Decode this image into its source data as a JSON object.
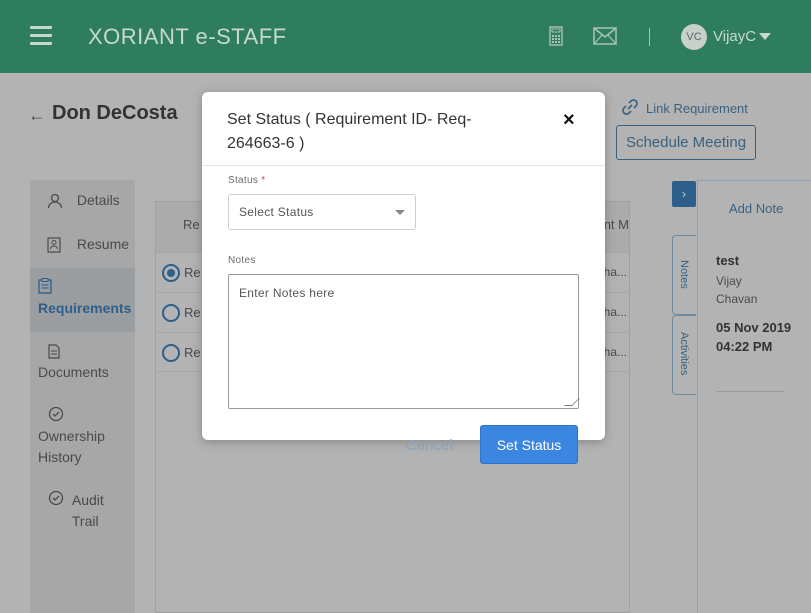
{
  "header": {
    "brand": "XORIANT e-STAFF",
    "user_initials": "VC",
    "username": "VijayC",
    "icons": [
      "menu-icon",
      "calculator-icon",
      "mail-icon",
      "caret-down-icon"
    ]
  },
  "page": {
    "back_label": "←",
    "title": "Don DeCosta",
    "link_requirement": "Link Requirement",
    "schedule_meeting": "Schedule Meeting"
  },
  "sidebar": {
    "items": [
      {
        "label": "Details",
        "icon": "user-icon"
      },
      {
        "label": "Resume",
        "icon": "resume-icon"
      },
      {
        "label": "Requirements",
        "icon": "clipboard-icon"
      },
      {
        "label": "Documents",
        "icon": "document-icon"
      },
      {
        "label": "Ownership History",
        "icon": "history-icon"
      },
      {
        "label": "Audit Trail",
        "icon": "audit-icon"
      }
    ]
  },
  "table": {
    "header_left": "Re",
    "header_right": "nt M",
    "rows": [
      {
        "label": "Re",
        "trail": "ha..."
      },
      {
        "label": "Re",
        "trail": "ha..."
      },
      {
        "label": "Re",
        "trail": "ha..."
      }
    ]
  },
  "notes_panel": {
    "toggle": "›",
    "add_note": "Add Note",
    "tabs": [
      "Notes",
      "Activities"
    ],
    "note": {
      "title": "test",
      "author": "Vijay Chavan",
      "date": "05 Nov 2019 04:22 PM"
    }
  },
  "modal": {
    "title": "Set Status ( Requirement ID- Req-264663-6 )",
    "close": "×",
    "status_label": "Status",
    "required_mark": "*",
    "status_placeholder": "Select Status",
    "notes_label": "Notes",
    "notes_placeholder": "Enter Notes here",
    "cancel": "Cancel",
    "submit": "Set Status"
  },
  "colors": {
    "topbar": "#2e7d5f",
    "primary_button": "#3a86e0",
    "link": "#39617f"
  }
}
